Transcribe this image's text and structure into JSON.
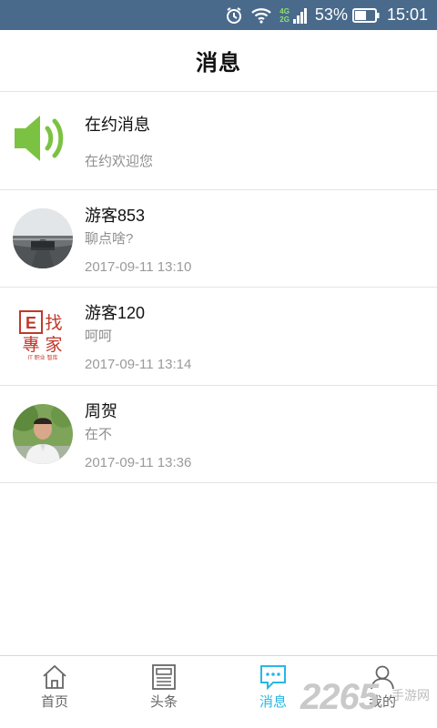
{
  "status_bar": {
    "network_top": "4G",
    "network_bottom": "2G",
    "battery": "53%",
    "time": "15:01"
  },
  "header": {
    "title": "消息"
  },
  "conversations": [
    {
      "name": "在约消息",
      "preview": "在约欢迎您",
      "time": "",
      "avatar": "speaker-icon"
    },
    {
      "name": "游客853",
      "preview": "聊点啥?",
      "time": "2017-09-11 13:10",
      "avatar": "road-photo"
    },
    {
      "name": "游客120",
      "preview": "呵呵",
      "time": "2017-09-11 13:14",
      "avatar": "e-expert-logo"
    },
    {
      "name": "周贺",
      "preview": "在不",
      "time": "2017-09-11 13:36",
      "avatar": "person-photo"
    }
  ],
  "logo_text": {
    "line1_left": "E",
    "line1_right": "找",
    "line2_left": "專",
    "line2_right": "家",
    "tagline": "IT 职业 智库"
  },
  "tabs": [
    {
      "label": "首页",
      "icon": "home-icon",
      "active": false
    },
    {
      "label": "头条",
      "icon": "newspaper-icon",
      "active": false
    },
    {
      "label": "消息",
      "icon": "chat-bubble-icon",
      "active": true
    },
    {
      "label": "我的",
      "icon": "person-icon",
      "active": false
    }
  ],
  "watermark": {
    "number": "2265",
    "text": "手游网"
  },
  "colors": {
    "status_bar": "#4a6a8c",
    "accent": "#29b6e6",
    "speaker_green": "#7cc242",
    "logo_red": "#c0392b"
  }
}
